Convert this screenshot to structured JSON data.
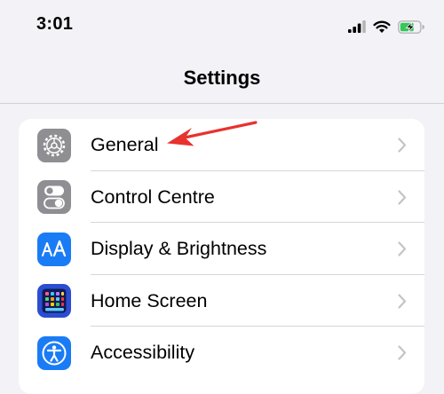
{
  "status_bar": {
    "time": "3:01",
    "icons": [
      "signal-icon",
      "wifi-icon",
      "battery-charging-icon"
    ]
  },
  "header": {
    "title": "Settings"
  },
  "settings": {
    "items": [
      {
        "label": "General",
        "icon": "gear-icon",
        "icon_color": "#8e8e93"
      },
      {
        "label": "Control Centre",
        "icon": "toggles-icon",
        "icon_color": "#8e8e93"
      },
      {
        "label": "Display & Brightness",
        "icon": "text-size-icon",
        "icon_color": "#1a7cf5"
      },
      {
        "label": "Home Screen",
        "icon": "app-grid-icon",
        "icon_color": "#2c4dd1"
      },
      {
        "label": "Accessibility",
        "icon": "accessibility-icon",
        "icon_color": "#1a7cf5"
      }
    ]
  },
  "annotation": {
    "arrow_color": "#e8322e",
    "points_to": "General"
  },
  "colors": {
    "background": "#f2f2f7",
    "group_background": "#ffffff",
    "chevron": "#c4c4c7",
    "battery_charging": "#35c759"
  }
}
